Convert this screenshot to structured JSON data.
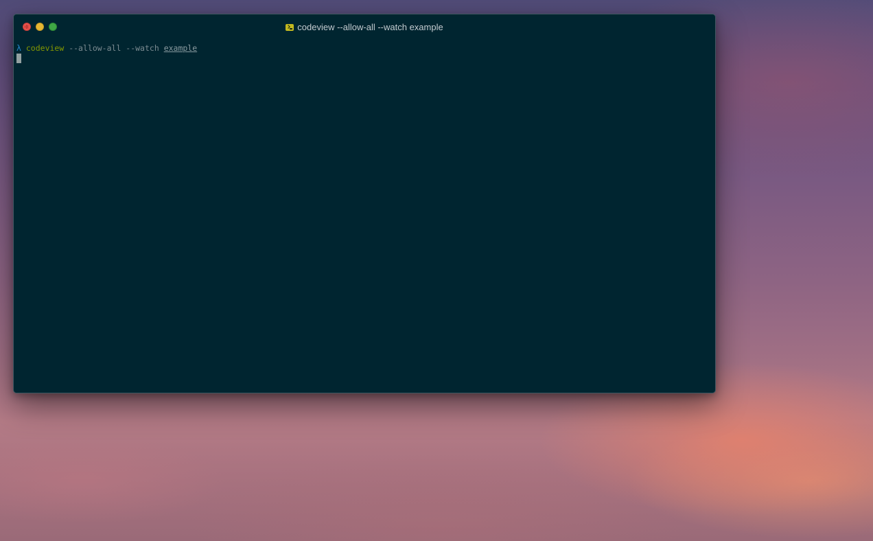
{
  "window": {
    "title": "codeview --allow-all --watch example",
    "icon": "terminal-icon"
  },
  "terminal": {
    "prompt_symbol": "λ",
    "command": "codeview",
    "flags": "--allow-all --watch",
    "argument": "example"
  },
  "colors": {
    "terminal_background": "#002530",
    "prompt": "#268bd2",
    "command": "#859900",
    "flags": "#7c8c92"
  }
}
